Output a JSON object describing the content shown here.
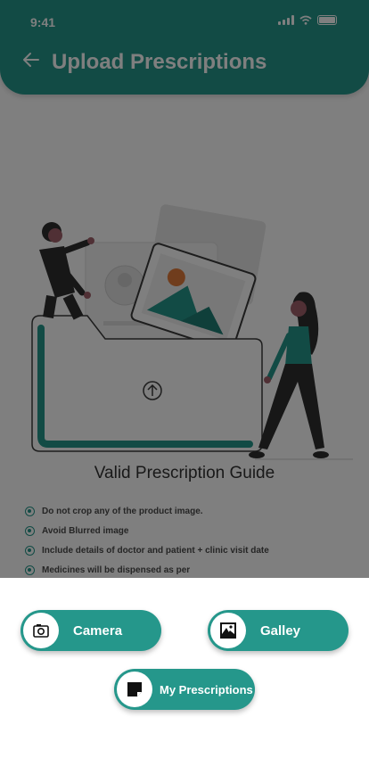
{
  "status_bar": {
    "time": "9:41"
  },
  "header": {
    "title": "Upload Prescriptions"
  },
  "guide": {
    "title": "Valid Prescription Guide",
    "items": [
      "Do not crop any of the product image.",
      "Avoid Blurred image",
      "Include details of doctor and patient + clinic visit date",
      "Medicines will be dispensed as per"
    ]
  },
  "sheet": {
    "camera_label": "Camera",
    "gallery_label": "Galley",
    "my_prescriptions_label": "My Prescriptions"
  },
  "colors": {
    "accent": "#25978b",
    "overlay": "rgba(0,0,0,0.5)"
  },
  "icons": {
    "back": "arrow-left-icon",
    "camera": "camera-icon",
    "gallery": "image-icon",
    "my_prescriptions": "note-icon"
  }
}
